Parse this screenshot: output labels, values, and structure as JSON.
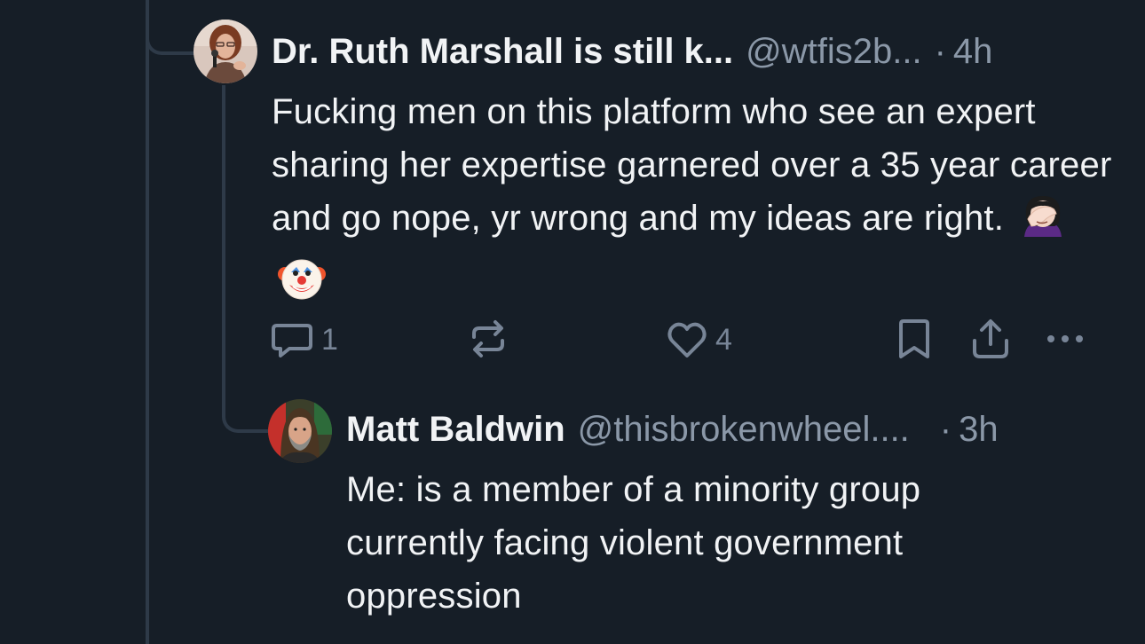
{
  "post1": {
    "display_name": "Dr. Ruth Marshall is still k...",
    "handle": "@wtfis2b...",
    "separator": "·",
    "time": "4h",
    "text": "Fucking men on this platform who see an expert sharing her expertise garnered over a 35 year career and go nope, yr wrong and my ideas are right.",
    "emojis": [
      "woman-facepalming-emoji",
      "clown-face-emoji"
    ],
    "avatar_icon": "avatar-ruth-marshall",
    "actions": {
      "reply_count": "1",
      "repost_count": "",
      "like_count": "4"
    }
  },
  "post2": {
    "display_name": "Matt Baldwin",
    "handle": "@thisbrokenwheel....",
    "separator": "·",
    "time": "3h",
    "text": "Me: is a member of a minority group currently facing violent government oppression",
    "avatar_icon": "avatar-matt-baldwin"
  },
  "colors": {
    "background": "#161e27",
    "thread_line": "#2e3a48",
    "primary_text": "#f1f3f5",
    "secondary_text": "#8b98a8",
    "icon": "#788597"
  }
}
